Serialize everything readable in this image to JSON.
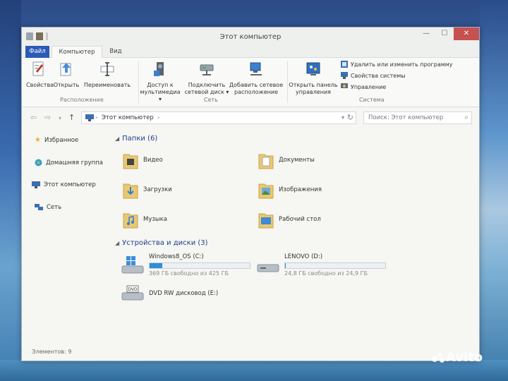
{
  "window": {
    "title": "Этот компьютер",
    "buttons": {
      "minimize": "—",
      "maximize": "☐",
      "close": "✕"
    }
  },
  "tabs": [
    "Файл",
    "Компьютер",
    "Вид"
  ],
  "ribbon": {
    "groups": [
      {
        "label": "Расположение",
        "buttons": [
          "Свойства",
          "Открыть",
          "Переименовать"
        ]
      },
      {
        "label": "Сеть",
        "buttons": [
          "Доступ к мультимедиа",
          "Подключить сетевой диск",
          "Добавить сетевое расположение"
        ]
      },
      {
        "label": "Система",
        "buttons": [
          "Открыть панель управления"
        ],
        "small_items": [
          "Удалить или изменить программу",
          "Свойства системы",
          "Управление"
        ]
      }
    ],
    "btn_lines": {
      "media": [
        "Доступ к",
        "мультимедиа ▾"
      ],
      "netdisk": [
        "Подключить",
        "сетевой диск ▾"
      ],
      "netloc": [
        "Добавить сетевое",
        "расположение"
      ],
      "cpanel": [
        "Открыть панель",
        "управления"
      ]
    }
  },
  "address": {
    "breadcrumb": "Этот компьютер",
    "search_placeholder": "Поиск: Этот компьютер"
  },
  "nav": {
    "items": [
      "Избранное",
      "Домашняя группа",
      "Этот компьютер",
      "Сеть"
    ]
  },
  "content": {
    "folders_header": "Папки (6)",
    "folders": [
      "Видео",
      "Документы",
      "Загрузки",
      "Изображения",
      "Музыка",
      "Рабочий стол"
    ],
    "devices_header": "Устройства и диски (3)",
    "drives": [
      {
        "name": "Windows8_OS (C:)",
        "free": "369 ГБ свободно из 425 ГБ",
        "used_fraction": 0.13
      },
      {
        "name": "LENOVO (D:)",
        "free": "24,8 ГБ свободно из 24,9 ГБ",
        "used_fraction": 0.004
      },
      {
        "name": "DVD RW дисковод (E:)"
      }
    ]
  },
  "status": "Элементов: 9",
  "watermark": "Avito"
}
